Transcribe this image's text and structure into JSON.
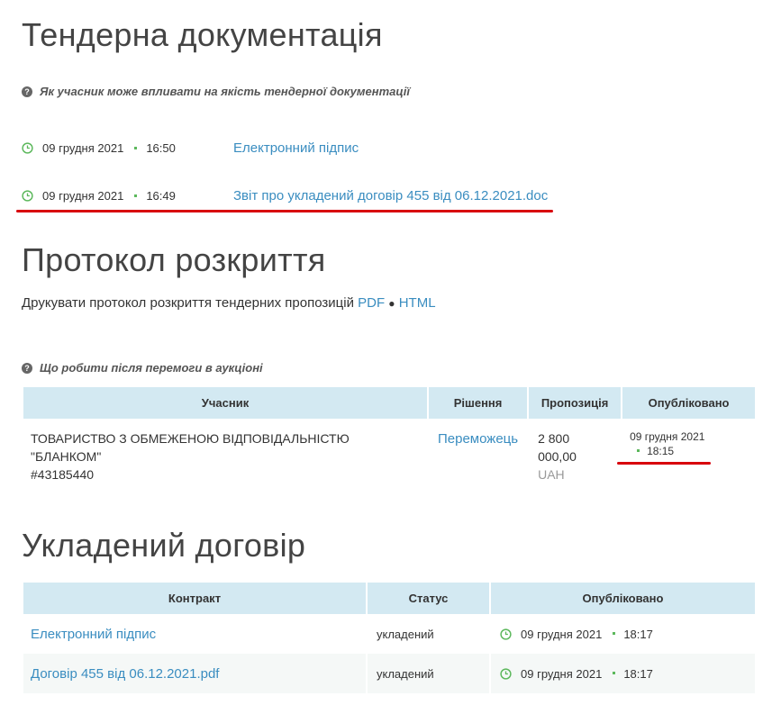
{
  "tender_docs": {
    "title": "Тендерна документація",
    "help_text": "Як учасник може впливати на якість тендерної документації",
    "items": [
      {
        "date": "09 грудня 2021",
        "time": "16:50",
        "link": "Електронний підпис"
      },
      {
        "date": "09 грудня 2021",
        "time": "16:49",
        "link": "Звіт про укладений договір 455 від 06.12.2021.doc"
      }
    ]
  },
  "protocol": {
    "title": "Протокол розкриття",
    "print_text": "Друкувати протокол розкриття тендерних пропозицій",
    "pdf_label": "PDF",
    "separator": "●",
    "html_label": "HTML",
    "help_text": "Що робити після перемоги в аукціоні",
    "table": {
      "headers": [
        "Учасник",
        "Рішення",
        "Пропозиція",
        "Опубліковано"
      ],
      "row": {
        "participant_line1": "ТОВАРИСТВО З ОБМЕЖЕНОЮ ВІДПОВІДАЛЬНІСТЮ",
        "participant_line2": "\"БЛАНКОМ\"",
        "participant_code": "#43185440",
        "decision": "Переможець",
        "amount_line1": "2 800",
        "amount_line2": "000,00",
        "currency": "UAH",
        "published_date": "09 грудня 2021",
        "published_time": "18:15"
      }
    }
  },
  "contract": {
    "title": "Укладений договір",
    "table": {
      "headers": [
        "Контракт",
        "Статус",
        "Опубліковано"
      ],
      "rows": [
        {
          "name": "Електронний підпис",
          "status": "укладений",
          "date": "09 грудня 2021",
          "time": "18:17"
        },
        {
          "name": "Договір 455 від 06.12.2021.pdf",
          "status": "укладений",
          "date": "09 грудня 2021",
          "time": "18:17"
        }
      ]
    }
  },
  "colors": {
    "link": "#3a8dc0",
    "header_bg": "#d3e9f2",
    "accent_green": "#5cb85c",
    "annotation_red": "#d8000c"
  },
  "icons": [
    "question-circle-icon",
    "clock-icon"
  ]
}
